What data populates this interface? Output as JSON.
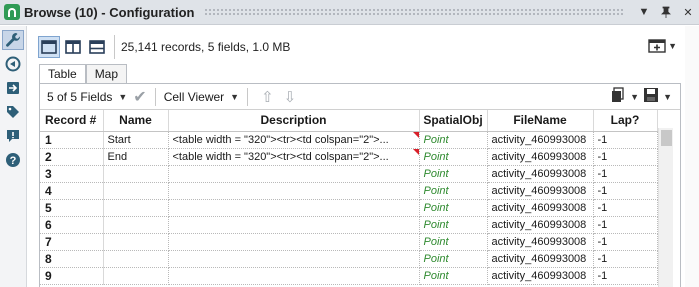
{
  "window": {
    "title": "Browse (10) - Configuration"
  },
  "toolbar": {
    "records_info": "25,141 records, 5 fields, 1.0 MB"
  },
  "tabs": [
    {
      "label": "Table",
      "active": true
    },
    {
      "label": "Map",
      "active": false
    }
  ],
  "subtoolbar": {
    "fields_select": "5 of 5 Fields",
    "cell_viewer": "Cell Viewer"
  },
  "table": {
    "columns": [
      "Record #",
      "Name",
      "Description",
      "SpatialObj",
      "FileName",
      "Lap?"
    ],
    "rows": [
      {
        "record": "1",
        "name": "Start",
        "description": "<table width = \"320\"><tr><td colspan=\"2\">...",
        "spatial": "Point",
        "filename": "activity_460993008",
        "lap": "-1"
      },
      {
        "record": "2",
        "name": "End",
        "description": "<table width = \"320\"><tr><td colspan=\"2\">...",
        "spatial": "Point",
        "filename": "activity_460993008",
        "lap": "-1"
      },
      {
        "record": "3",
        "name": "",
        "description": "",
        "spatial": "Point",
        "filename": "activity_460993008",
        "lap": "-1"
      },
      {
        "record": "4",
        "name": "",
        "description": "",
        "spatial": "Point",
        "filename": "activity_460993008",
        "lap": "-1"
      },
      {
        "record": "5",
        "name": "",
        "description": "",
        "spatial": "Point",
        "filename": "activity_460993008",
        "lap": "-1"
      },
      {
        "record": "6",
        "name": "",
        "description": "",
        "spatial": "Point",
        "filename": "activity_460993008",
        "lap": "-1"
      },
      {
        "record": "7",
        "name": "",
        "description": "",
        "spatial": "Point",
        "filename": "activity_460993008",
        "lap": "-1"
      },
      {
        "record": "8",
        "name": "",
        "description": "",
        "spatial": "Point",
        "filename": "activity_460993008",
        "lap": "-1"
      },
      {
        "record": "9",
        "name": "",
        "description": "",
        "spatial": "Point",
        "filename": "activity_460993008",
        "lap": "-1"
      }
    ]
  },
  "colors": {
    "title_bar": "#dfe3e8",
    "accent_green": "#2f9a55",
    "spatial_text": "#2f8a2f",
    "comment_marker": "#d8202a",
    "sidebar_icon": "#2e5f78"
  }
}
